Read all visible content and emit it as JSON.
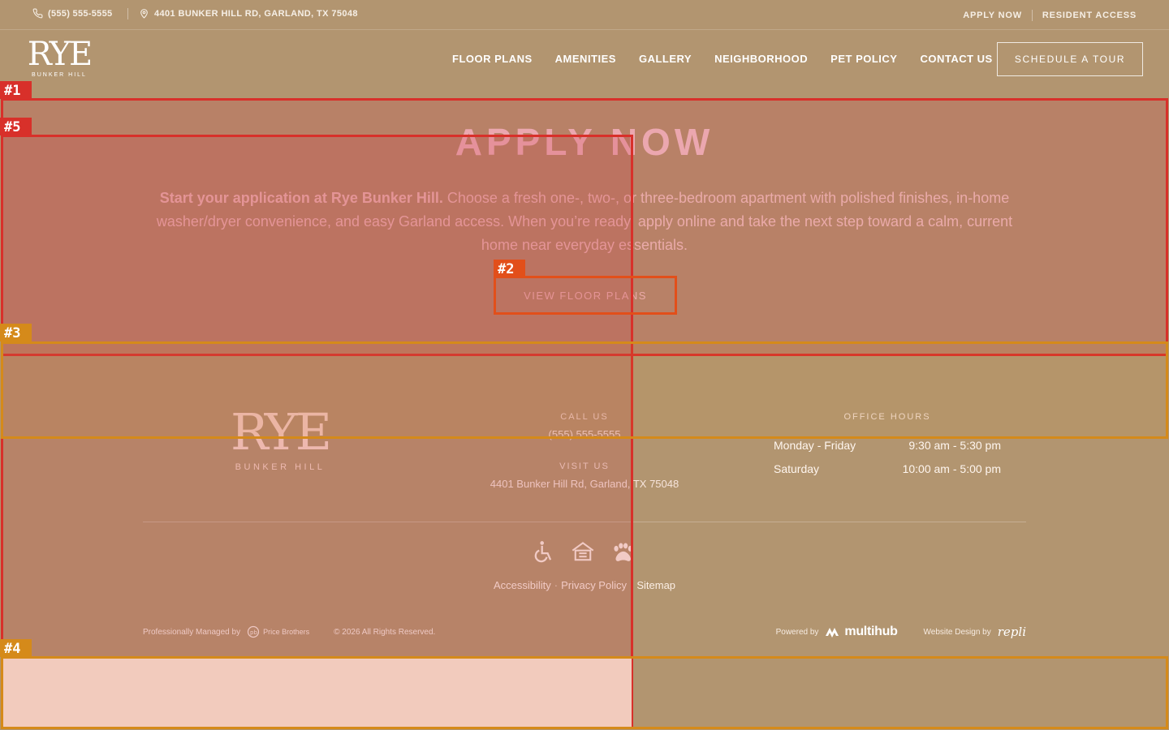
{
  "topbar": {
    "phone": "(555) 555-5555",
    "address": "4401 BUNKER HILL RD, GARLAND, TX 75048",
    "links": [
      "APPLY NOW",
      "RESIDENT ACCESS"
    ]
  },
  "header": {
    "logo_text": "RYE",
    "logo_sub": "BUNKER HILL",
    "nav": [
      "FLOOR PLANS",
      "AMENITIES",
      "GALLERY",
      "NEIGHBORHOOD",
      "PET POLICY",
      "CONTACT US"
    ],
    "tour_button": "SCHEDULE A TOUR"
  },
  "hero": {
    "title": "APPLY NOW",
    "lead_bold": "Start your application at Rye Bunker Hill.",
    "lead_rest": " Choose a fresh one-, two-, or three-bedroom apartment with polished finishes, in-home washer/dryer convenience, and easy Garland access. When you’re ready, apply online and take the next step toward a calm, current home near everyday essentials.",
    "button": "VIEW FLOOR PLANS"
  },
  "footer": {
    "logo_text": "RYE",
    "logo_sub": "BUNKER HILL",
    "call_label": "CALL US",
    "call_value": "(555) 555-5555",
    "visit_label": "VISIT US",
    "visit_value": "4401 Bunker Hill Rd, Garland, TX 75048",
    "hours_label": "OFFICE HOURS",
    "hours": [
      {
        "day": "Monday - Friday",
        "time": "9:30 am - 5:30 pm"
      },
      {
        "day": "Saturday",
        "time": "10:00 am - 5:00 pm"
      }
    ],
    "links": [
      "Accessibility",
      "Privacy Policy",
      "Sitemap"
    ],
    "managed_by": "Professionally Managed by",
    "manager_name": "Price Brothers",
    "copyright": "© 2026 All Rights Reserved.",
    "powered_by": "Powered by",
    "powered_brand": "multihub",
    "design_by": "Website Design by",
    "design_brand": "repli"
  },
  "annotations": {
    "labels": [
      "#1",
      "#2",
      "#3",
      "#4",
      "#5"
    ],
    "colors": {
      "red": "#d8302a",
      "orange": "#e24f1a",
      "amber": "#d58a1a"
    }
  },
  "colors": {
    "background": "#b29570",
    "hero_title": "#f4c6cc"
  }
}
